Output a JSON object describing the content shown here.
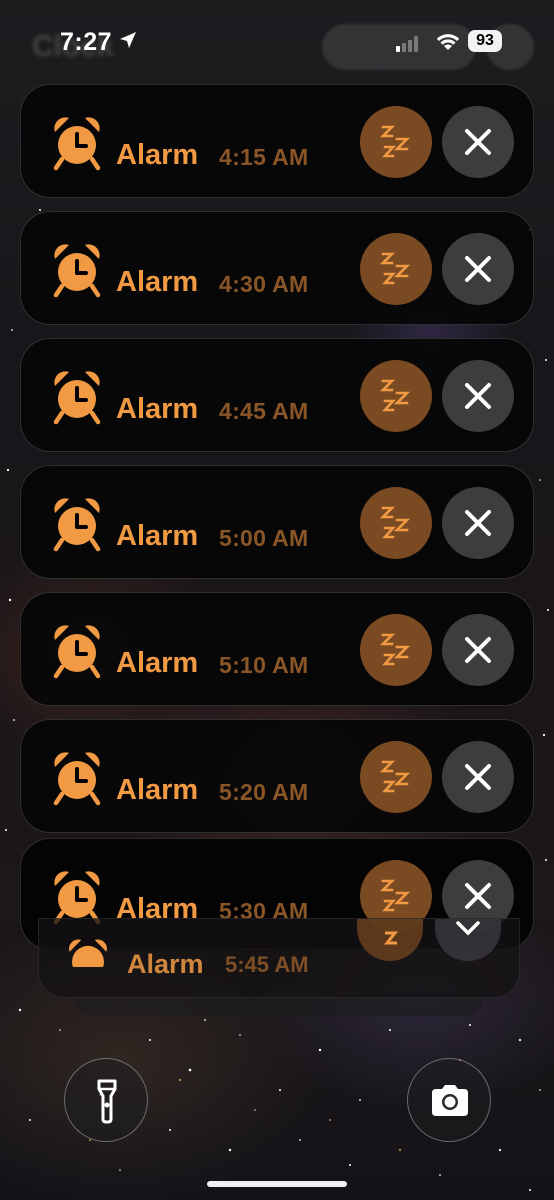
{
  "status_bar": {
    "time": "7:27",
    "battery": "93",
    "background_app": "Clock"
  },
  "colors": {
    "alarm_orange": "#f19a43",
    "time_brown": "#8a5628",
    "snooze_bg": "#7a4a23",
    "dismiss_bg": "#3d3c3e"
  },
  "notifications": [
    {
      "title": "Alarm",
      "time": "4:15 AM"
    },
    {
      "title": "Alarm",
      "time": "4:30 AM"
    },
    {
      "title": "Alarm",
      "time": "4:45 AM"
    },
    {
      "title": "Alarm",
      "time": "5:00 AM"
    },
    {
      "title": "Alarm",
      "time": "5:10 AM"
    },
    {
      "title": "Alarm",
      "time": "5:20 AM"
    },
    {
      "title": "Alarm",
      "time": "5:30 AM"
    }
  ],
  "stacked_notification": {
    "title": "Alarm",
    "time": "5:45 AM"
  },
  "icons": {
    "alarm": "alarm-clock-icon",
    "snooze": "snooze-zzz-icon",
    "dismiss": "close-icon",
    "flashlight": "flashlight-icon",
    "camera": "camera-icon"
  }
}
